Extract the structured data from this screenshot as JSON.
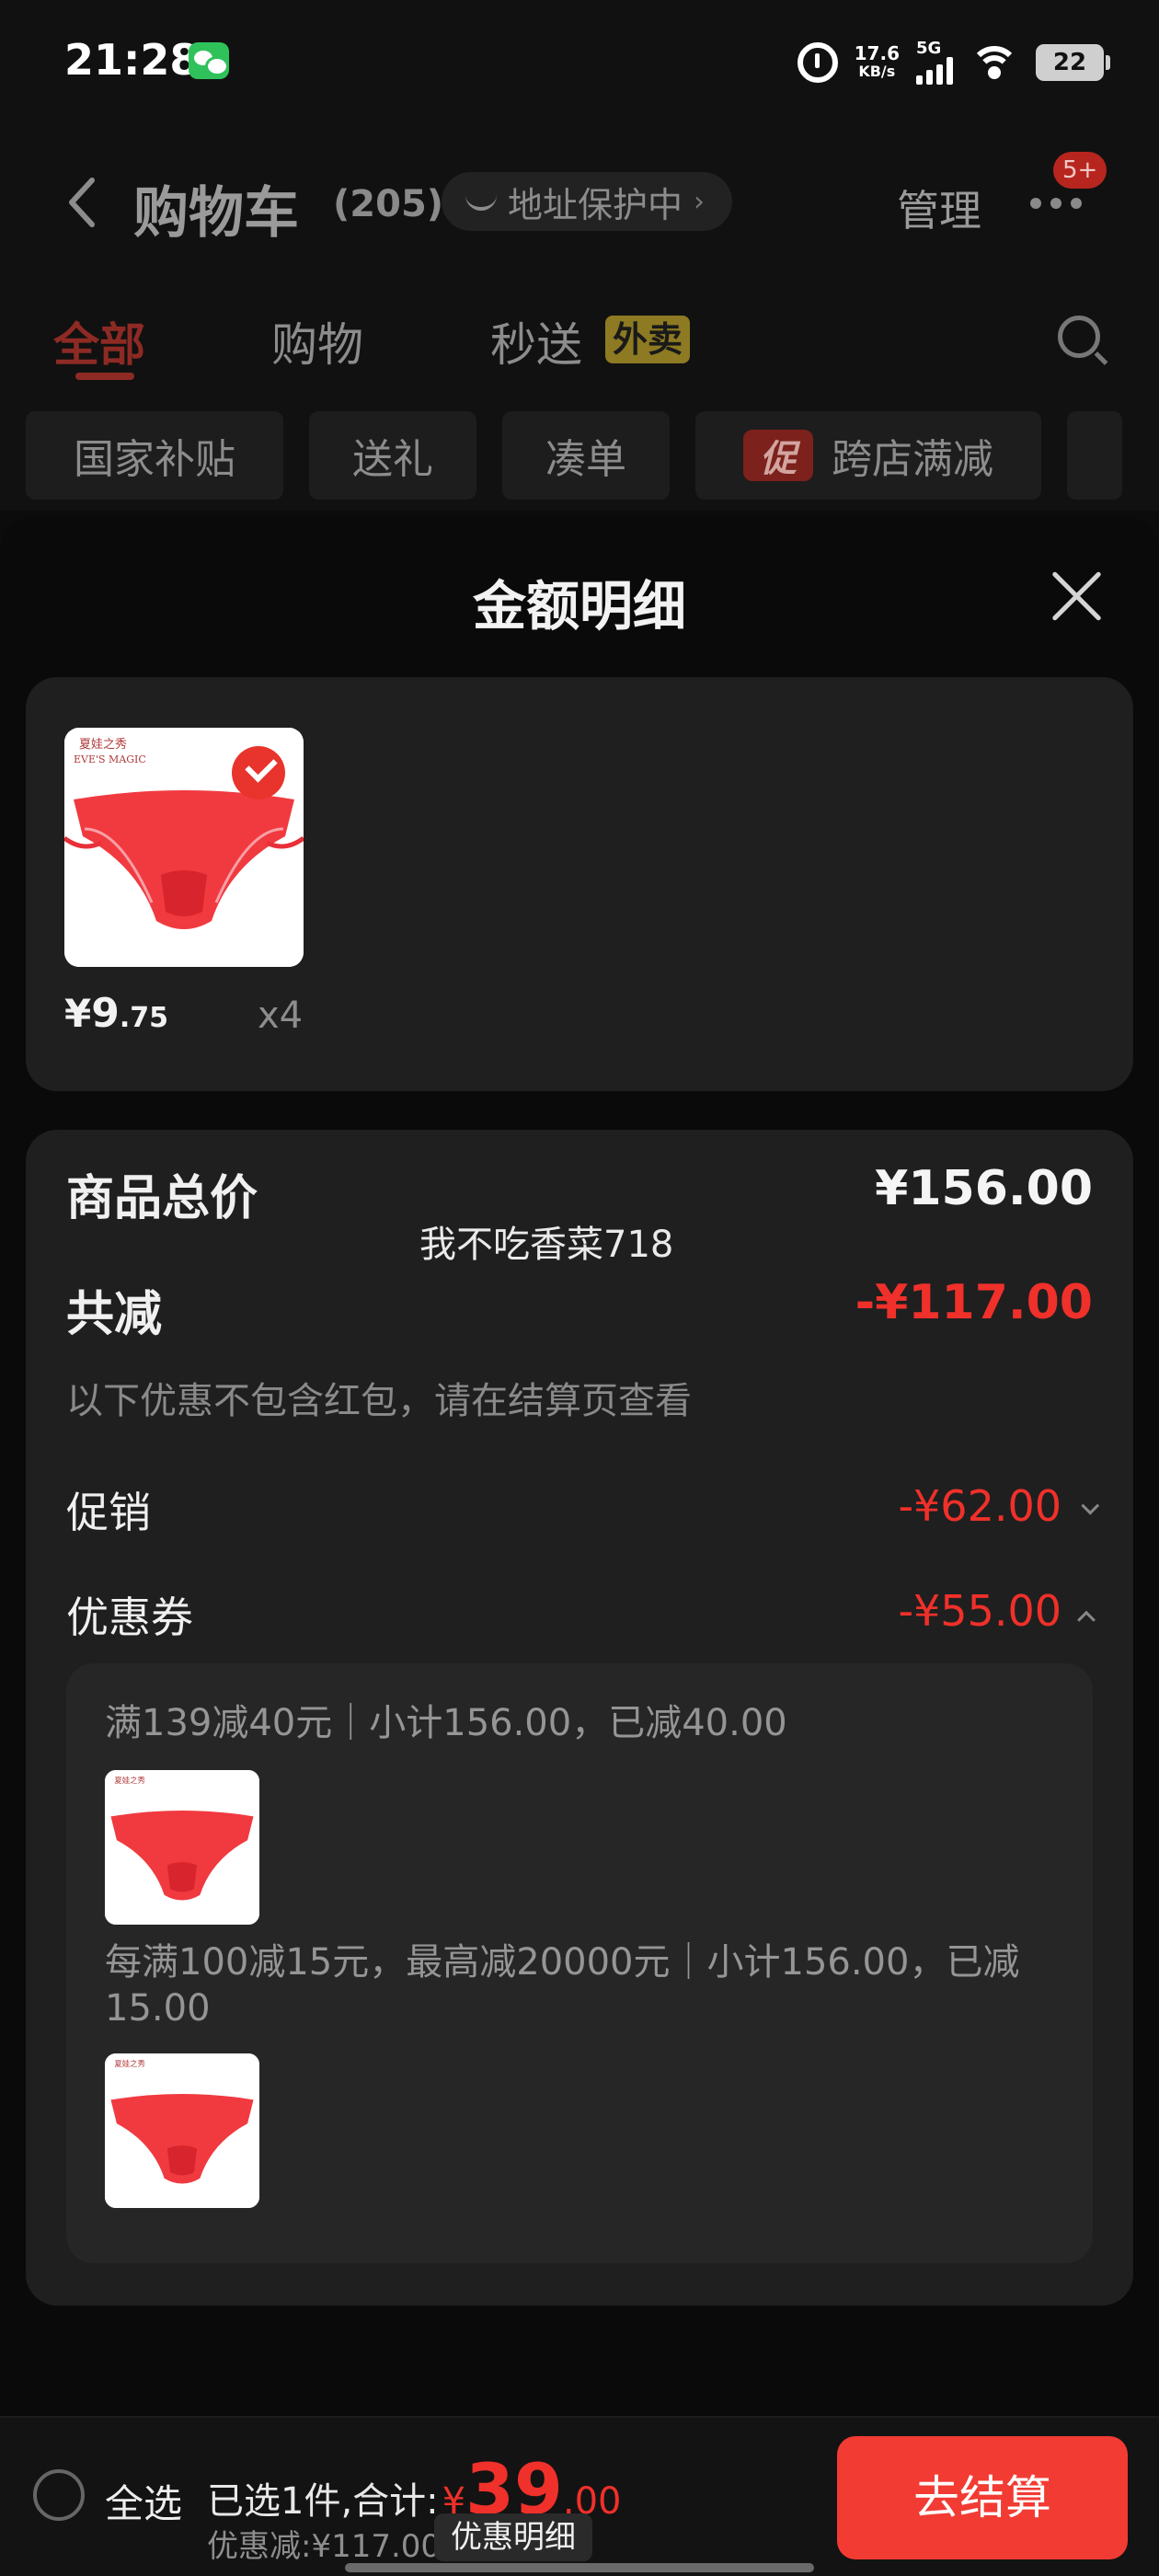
{
  "status_bar": {
    "time": "21:28",
    "net_speed_value": "17.6",
    "net_speed_unit": "KB/s",
    "network": "5G",
    "battery": "22"
  },
  "header": {
    "title": "购物车",
    "count": "(205)",
    "address_protection": "地址保护中",
    "manage": "管理",
    "more_badge": "5+"
  },
  "tabs": [
    {
      "label": "全部",
      "active": true
    },
    {
      "label": "购物",
      "active": false
    },
    {
      "label": "秒送",
      "active": false
    }
  ],
  "tab_badge": "外卖",
  "chips": [
    {
      "label": "国家补贴"
    },
    {
      "label": "送礼"
    },
    {
      "label": "凑单"
    },
    {
      "label": "跨店满减",
      "tag": "促"
    }
  ],
  "sheet": {
    "title": "金额明细",
    "product": {
      "brand_text": "夏娃之秀 EVE'S MAGIC",
      "price_yen": "¥",
      "price_int": "9",
      "price_dec": ".75",
      "quantity": "x4"
    },
    "total_label": "商品总价",
    "total_value": "¥156.00",
    "watermark": "我不吃香菜718",
    "reduce_label": "共减",
    "reduce_value": "-¥117.00",
    "reduce_note": "以下优惠不包含红包，请在结算页查看",
    "promo_label": "促销",
    "promo_value": "-¥62.00",
    "coupon_label": "优惠券",
    "coupon_value": "-¥55.00",
    "coupons": [
      {
        "text": "满139减40元｜小计156.00，已减40.00"
      },
      {
        "text": "每满100减15元，最高减20000元｜小计156.00，已减15.00"
      }
    ]
  },
  "bottom": {
    "select_all": "全选",
    "summary_prefix": "已选1件,合计:",
    "sum_yen": "¥",
    "sum_int": "39",
    "sum_dec": ".00",
    "discount": "优惠减:¥117.00",
    "detail_button": "优惠明细",
    "checkout": "去结算"
  },
  "colors": {
    "accent_red": "#f0302a",
    "checkout_red": "#f23b33",
    "card_bg": "#1f1f1f"
  }
}
